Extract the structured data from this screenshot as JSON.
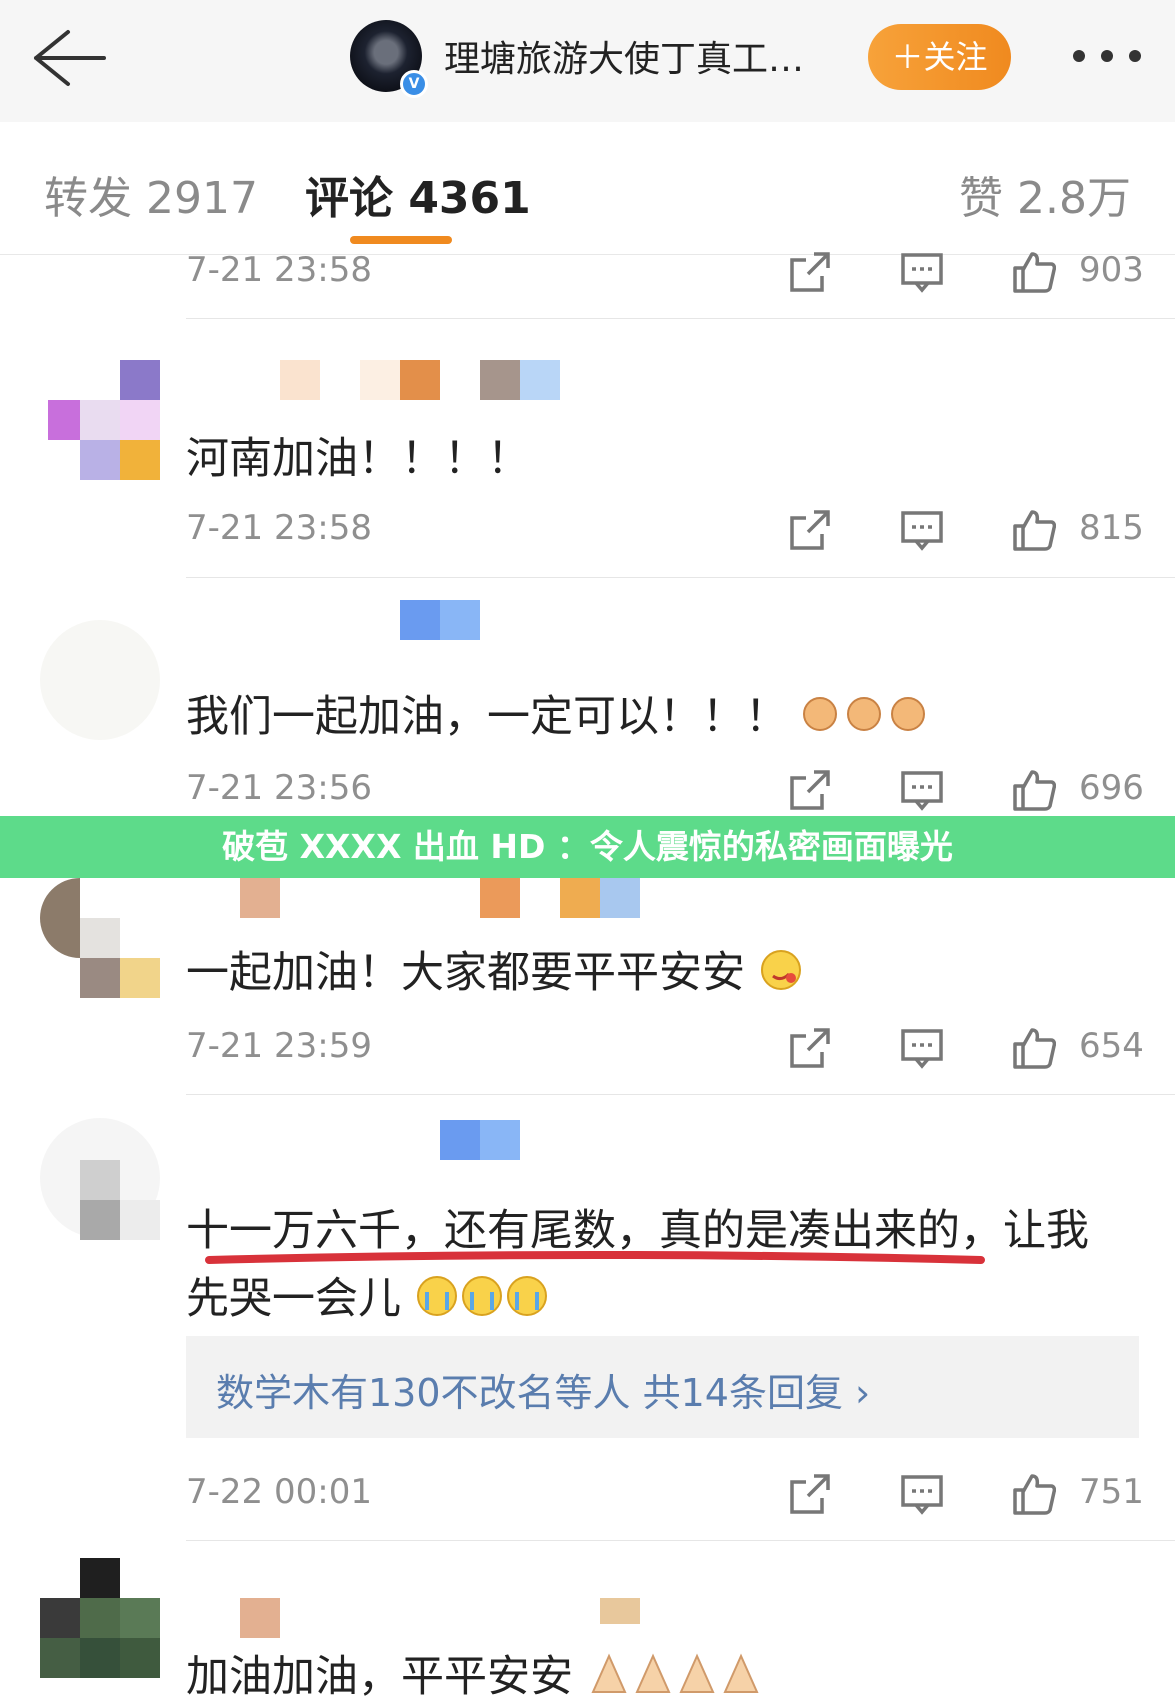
{
  "header": {
    "account_name": "理塘旅游大使丁真工…",
    "follow_label": "＋关注",
    "verified_badge": "V"
  },
  "tabs": {
    "repost": "转发 2917",
    "comment": "评论 4361",
    "like": "赞 2.8万"
  },
  "banner": {
    "text": "破苞 XXXX 出血 HD ：令人震惊的私密画面曝光"
  },
  "comments": [
    {
      "time": "7-21 23:58",
      "likes": "903"
    },
    {
      "text": "河南加油！！！！",
      "time": "7-21 23:58",
      "likes": "815"
    },
    {
      "text": "我们一起加油，一定可以！！！",
      "time": "7-21 23:56",
      "likes": "696"
    },
    {
      "text": "一起加油！大家都要平平安安",
      "time": "7-21 23:59",
      "likes": "654"
    },
    {
      "text_line1": "十一万六千，还有尾数，真的是凑出来的，让我",
      "text_line2": "先哭一会儿",
      "time": "7-22 00:01",
      "likes": "751",
      "reply_summary": "数学木有130不改名等人  共14条回复 ›"
    },
    {
      "text": "加油加油，平平安安"
    }
  ],
  "colors": {
    "accent": "#f08a1f",
    "banner": "#5ddb8a",
    "reply_link": "#5a7dae",
    "underline_red": "#d8323a"
  }
}
